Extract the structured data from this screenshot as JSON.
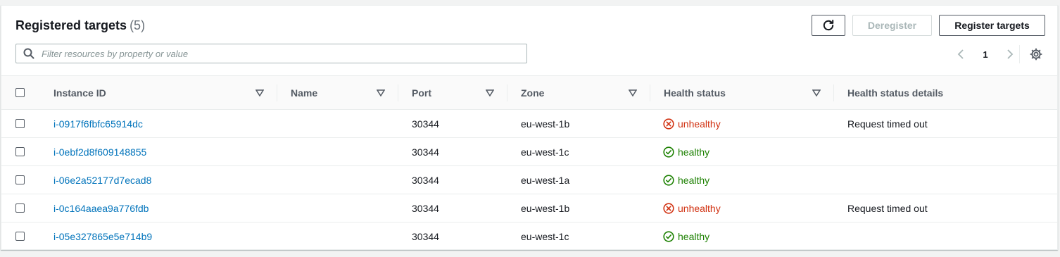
{
  "header": {
    "title": "Registered targets",
    "count": "(5)",
    "deregister_label": "Deregister",
    "register_label": "Register targets"
  },
  "search": {
    "placeholder": "Filter resources by property or value"
  },
  "pagination": {
    "current_page": "1"
  },
  "columns": {
    "instance_id": "Instance ID",
    "name": "Name",
    "port": "Port",
    "zone": "Zone",
    "health_status": "Health status",
    "health_status_details": "Health status details"
  },
  "rows": [
    {
      "instance_id": "i-0917f6fbfc65914dc",
      "name": "",
      "port": "30344",
      "zone": "eu-west-1b",
      "health": "unhealthy",
      "details": "Request timed out"
    },
    {
      "instance_id": "i-0ebf2d8f609148855",
      "name": "",
      "port": "30344",
      "zone": "eu-west-1c",
      "health": "healthy",
      "details": ""
    },
    {
      "instance_id": "i-06e2a52177d7ecad8",
      "name": "",
      "port": "30344",
      "zone": "eu-west-1a",
      "health": "healthy",
      "details": ""
    },
    {
      "instance_id": "i-0c164aaea9a776fdb",
      "name": "",
      "port": "30344",
      "zone": "eu-west-1b",
      "health": "unhealthy",
      "details": "Request timed out"
    },
    {
      "instance_id": "i-05e327865e5e714b9",
      "name": "",
      "port": "30344",
      "zone": "eu-west-1c",
      "health": "healthy",
      "details": ""
    }
  ],
  "colors": {
    "link": "#0073bb",
    "healthy": "#1d8102",
    "unhealthy": "#d13212"
  },
  "icons": {
    "refresh": "refresh-icon",
    "search": "search-icon",
    "prev": "chevron-left-icon",
    "next": "chevron-right-icon",
    "settings": "gear-icon",
    "healthy": "check-circle-icon",
    "unhealthy": "x-circle-icon",
    "sort": "sort-caret-icon"
  }
}
